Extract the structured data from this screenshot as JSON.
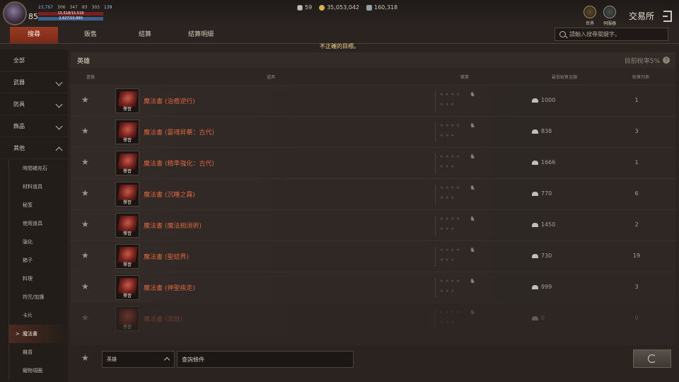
{
  "player": {
    "level": "85",
    "stats": [
      "23,767",
      "306",
      "347",
      "83",
      "303",
      "139"
    ],
    "hp": "15,518/15,518",
    "mp": "2,627/10,890"
  },
  "currency": [
    {
      "icon": "diamond-icon",
      "value": "59"
    },
    {
      "icon": "gold-coin-icon",
      "value": "35,053,042"
    },
    {
      "icon": "silver-icon",
      "value": "160,318"
    }
  ],
  "topright": {
    "world_label": "世界",
    "server_label": "伺服器",
    "title": "交易所"
  },
  "tabs": [
    "搜尋",
    "販售",
    "結算",
    "結算明細"
  ],
  "search": {
    "placeholder": "請輸入搜尋關鍵字。"
  },
  "toast": "不正確的目標。",
  "sidebar": {
    "categories": [
      {
        "label": "全部"
      },
      {
        "label": "武器"
      },
      {
        "label": "防具"
      },
      {
        "label": "飾品"
      },
      {
        "label": "其他"
      }
    ],
    "subs": [
      "時間補充石",
      "材料道具",
      "秘笈",
      "使用道具",
      "強化",
      "箱子",
      "料理",
      "符咒/加護",
      "卡片",
      "魔法書",
      "雜貨",
      "寵物項圈"
    ]
  },
  "main": {
    "title": "英雄",
    "rate_label": "目前稅率5%",
    "columns": {
      "fav": "書籤",
      "item": "道具",
      "job": "職業",
      "price": "最低販售金額",
      "listings": "販售列表"
    }
  },
  "rows": [
    {
      "tag": "學習",
      "name": "魔法書 (治癒逆行)",
      "price": "1000",
      "count": "1"
    },
    {
      "tag": "學習",
      "name": "魔法書 (靈魂昇華：古代)",
      "price": "838",
      "count": "3"
    },
    {
      "tag": "學習",
      "name": "魔法書 (精準強化：古代)",
      "price": "1666",
      "count": "1"
    },
    {
      "tag": "學習",
      "name": "魔法書 (沉睡之霧)",
      "price": "770",
      "count": "6"
    },
    {
      "tag": "學習",
      "name": "魔法書 (魔法相消術)",
      "price": "1450",
      "count": "2"
    },
    {
      "tag": "學習",
      "name": "魔法書 (聖結界)",
      "price": "730",
      "count": "19"
    },
    {
      "tag": "學習",
      "name": "魔法書 (神聖疾走)",
      "price": "999",
      "count": "3"
    },
    {
      "tag": "學習",
      "name": "魔法書 (流放)",
      "price": "0",
      "count": "0"
    }
  ],
  "filter": {
    "grade": "英雄",
    "query": "查詢條件"
  }
}
